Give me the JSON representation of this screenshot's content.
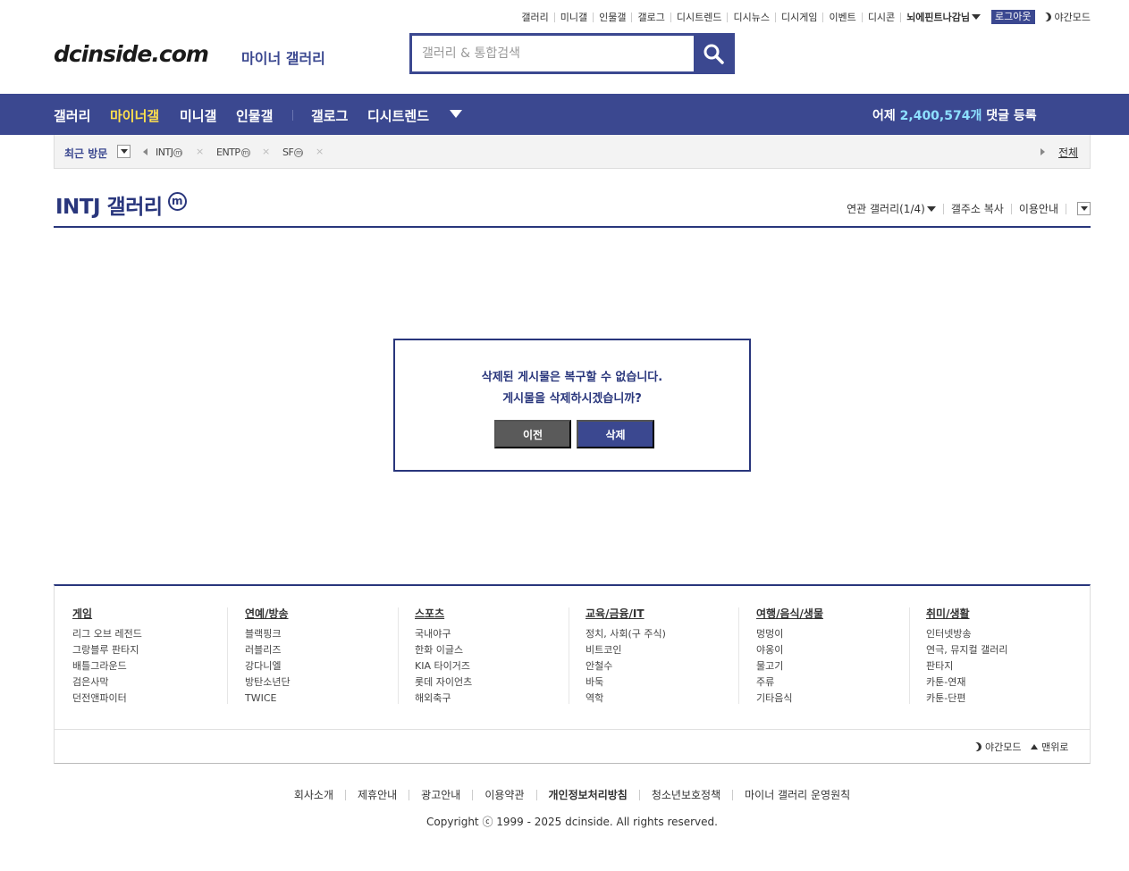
{
  "top_links": [
    "갤러리",
    "미니갤",
    "인물갤",
    "갤로그",
    "디시트렌드",
    "디시뉴스",
    "디시게임",
    "이벤트",
    "디시콘"
  ],
  "user_name": "뇌에핀트나감님",
  "logout_label": "로그아웃",
  "night_mode_label": "야간모드",
  "logo": {
    "text": "dcinside.com",
    "sub": "마이너 갤러리"
  },
  "search": {
    "placeholder": "갤러리 & 통합검색"
  },
  "nav": {
    "items": [
      "갤러리",
      "마이너갤",
      "미니갤",
      "인물갤",
      "갤로그",
      "디시트렌드"
    ],
    "active_index": 1,
    "stats_prefix": "어제",
    "stats_number": "2,400,574개",
    "stats_suffix": "댓글 등록"
  },
  "recent": {
    "label": "최근 방문",
    "items": [
      "INTJ",
      "ENTP",
      "SF"
    ],
    "badge": "ⓜ",
    "all_label": "전체"
  },
  "gallery": {
    "title": "INTJ 갤러리",
    "badge": "m",
    "tools": [
      "연관 갤러리(1/4)",
      "갤주소 복사",
      "이용안내"
    ]
  },
  "dialog": {
    "line1": "삭제된 게시물은 복구할 수 없습니다.",
    "line2": "게시물을 삭제하시겠습니까?",
    "prev_label": "이전",
    "delete_label": "삭제"
  },
  "footer_categories": [
    {
      "title": "게임",
      "links": [
        "리그 오브 레전드",
        "그랑블루 판타지",
        "배틀그라운드",
        "검은사막",
        "던전앤파이터"
      ]
    },
    {
      "title": "연예/방송",
      "links": [
        "블랙핑크",
        "러블리즈",
        "강다니엘",
        "방탄소년단",
        "TWICE"
      ]
    },
    {
      "title": "스포츠",
      "links": [
        "국내야구",
        "한화 이글스",
        "KIA 타이거즈",
        "롯데 자이언츠",
        "해외축구"
      ]
    },
    {
      "title": "교육/금융/IT",
      "links": [
        "정치, 사회(구 주식)",
        "비트코인",
        "안철수",
        "바둑",
        "역학"
      ]
    },
    {
      "title": "여행/음식/생물",
      "links": [
        "멍멍이",
        "야옹이",
        "물고기",
        "주류",
        "기타음식"
      ]
    },
    {
      "title": "취미/생활",
      "links": [
        "인터넷방송",
        "연극, 뮤지컬 갤러리",
        "판타지",
        "카툰-연재",
        "카툰-단편"
      ]
    }
  ],
  "footer_night_label": "야간모드",
  "footer_top_label": "맨위로",
  "bottom_links": [
    "회사소개",
    "제휴안내",
    "광고안내",
    "이용약관",
    "개인정보처리방침",
    "청소년보호정책",
    "마이너 갤러리 운영원칙"
  ],
  "bold_bottom_index": 4,
  "copyright": "Copyright ⓒ 1999 - 2025 dcinside. All rights reserved.",
  "colors": {
    "brand": "#3b4890",
    "title": "#29367c",
    "nav_active": "#ffe14d",
    "stats_number": "#8de0ff",
    "prev_button": "#5a5a5a"
  }
}
